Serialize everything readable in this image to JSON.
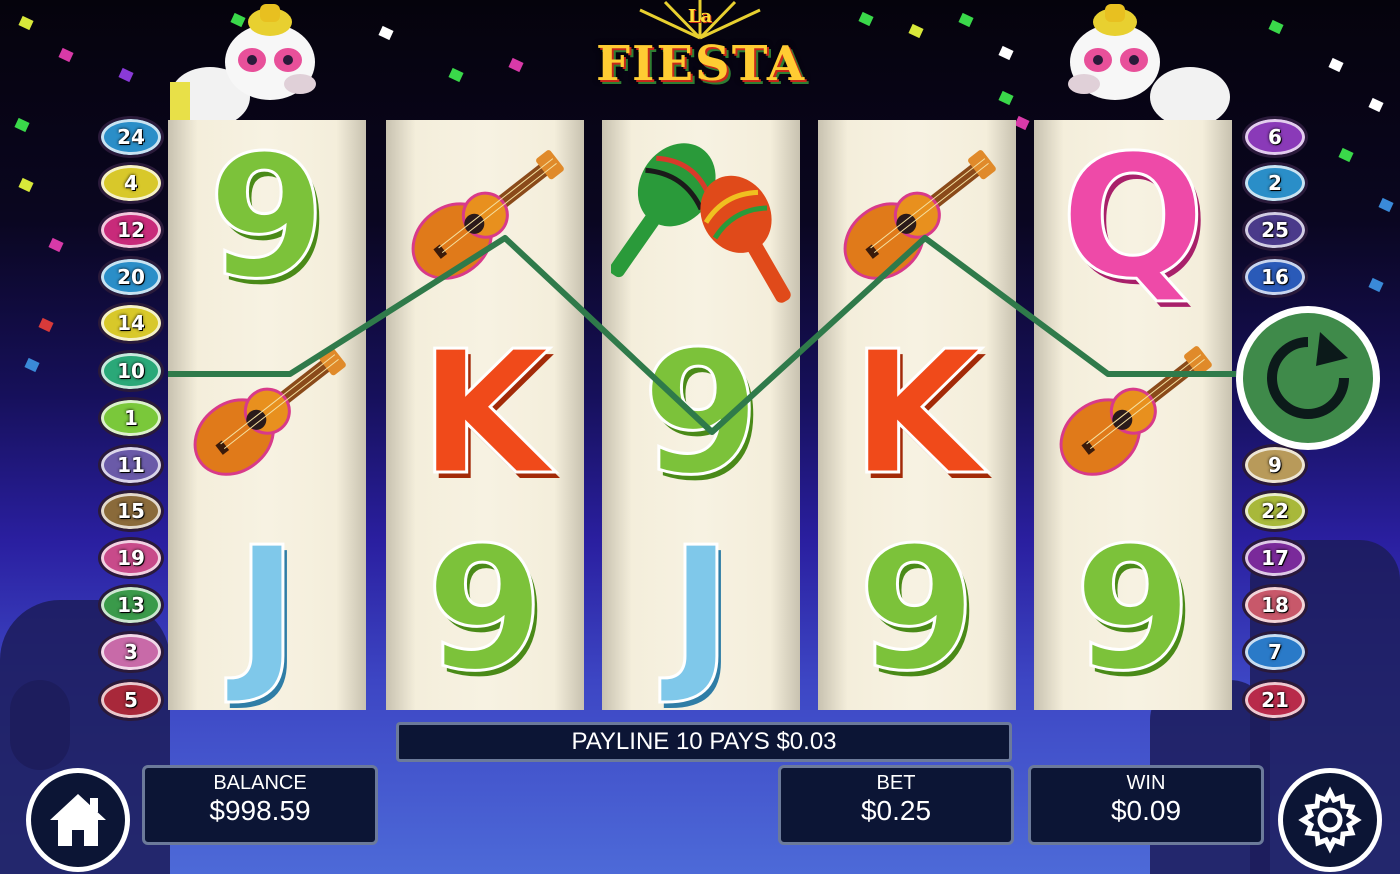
{
  "game": {
    "title_small": "La",
    "title_main": "FIESTA"
  },
  "paylines_left": [
    "24",
    "4",
    "12",
    "20",
    "14",
    "10",
    "1",
    "11",
    "15",
    "19",
    "13",
    "3",
    "5"
  ],
  "paylines_right": [
    "6",
    "2",
    "25",
    "16",
    "9",
    "22",
    "17",
    "18",
    "7",
    "21"
  ],
  "payline_colors_left": [
    "#2a8ec8",
    "#d8c82a",
    "#c82a7a",
    "#2a8ec8",
    "#d8c82a",
    "#2aa878",
    "#7ac83a",
    "#6a5aa8",
    "#8a6a3a",
    "#c84a8a",
    "#3a9a4a",
    "#c86aa8",
    "#a8283a"
  ],
  "payline_colors_right": [
    "#8a3ab8",
    "#2a8ec8",
    "#4a3a8a",
    "#2a5ab8",
    "#b89a5a",
    "#a8b83a",
    "#7a2a9a",
    "#c8586a",
    "#2a7ac8",
    "#b82a4a"
  ],
  "reels": [
    {
      "symbols": [
        "9",
        "guitar",
        "J"
      ]
    },
    {
      "symbols": [
        "guitar",
        "K",
        "9"
      ]
    },
    {
      "symbols": [
        "maracas",
        "9",
        "J"
      ]
    },
    {
      "symbols": [
        "guitar",
        "K",
        "9"
      ]
    },
    {
      "symbols": [
        "Q",
        "guitar",
        "9"
      ]
    }
  ],
  "win_message": "PAYLINE 10 PAYS $0.03",
  "balance": {
    "label": "BALANCE",
    "value": "$998.59"
  },
  "bet": {
    "label": "BET",
    "value": "$0.25"
  },
  "win": {
    "label": "WIN",
    "value": "$0.09"
  },
  "icons": {
    "home": "home-icon",
    "settings": "gear-icon",
    "spin": "spin-refresh-icon"
  },
  "colors": {
    "payline": "#2f7a4a",
    "panel_bg": "#0c1535",
    "spin_button": "#3f8a4a"
  }
}
